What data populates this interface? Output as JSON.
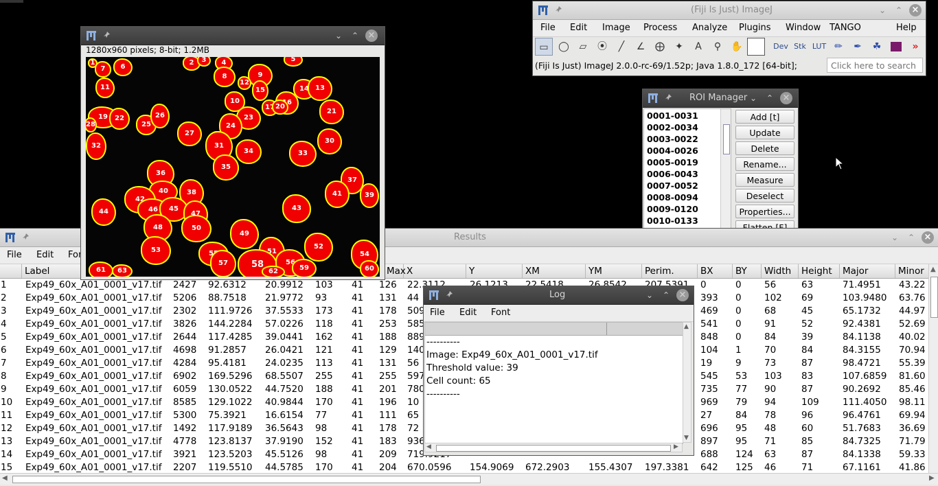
{
  "imagej": {
    "title": "(Fiji Is Just) ImageJ",
    "menus": [
      "File",
      "Edit",
      "Image",
      "Process",
      "Analyze",
      "Plugins",
      "Window",
      "TANGO",
      "Help"
    ],
    "tool_labels": {
      "dev": "Dev",
      "stk": "Stk",
      "lut": "LUT",
      "text": "A"
    },
    "status": "(Fiji Is Just) ImageJ 2.0.0-rc-69/1.52p; Java 1.8.0_172 [64-bit];",
    "search_placeholder": "Click here to search"
  },
  "image_window": {
    "info": "1280x960 pixels; 8-bit; 1.2MB",
    "cell_labels": [
      "1",
      "7",
      "6",
      "2",
      "3",
      "4",
      "5",
      "8",
      "11",
      "9",
      "12",
      "15",
      "14",
      "13",
      "10",
      "16",
      "17",
      "20",
      "21",
      "19",
      "22",
      "25",
      "26",
      "23",
      "24",
      "28",
      "27",
      "32",
      "29",
      "31",
      "30",
      "34",
      "33",
      "35",
      "36",
      "37",
      "38",
      "40",
      "42",
      "41",
      "39",
      "46",
      "45",
      "44",
      "47",
      "43",
      "48",
      "50",
      "49",
      "51",
      "52",
      "53",
      "55",
      "57",
      "58",
      "56",
      "54",
      "61",
      "63",
      "62",
      "59",
      "60"
    ]
  },
  "roi_manager": {
    "title": "ROI Manager",
    "items": [
      "0001-0031",
      "0002-0034",
      "0003-0022",
      "0004-0026",
      "0005-0019",
      "0006-0043",
      "0007-0052",
      "0008-0094",
      "0009-0120",
      "0010-0133"
    ],
    "buttons": [
      "Add [t]",
      "Update",
      "Delete",
      "Rename...",
      "Measure",
      "Deselect",
      "Properties...",
      "Flatten [F]"
    ]
  },
  "results": {
    "title": "Results",
    "menus": [
      "File",
      "Edit",
      "Font"
    ],
    "columns": [
      "",
      "Label",
      "",
      "",
      "",
      "",
      "",
      "Max",
      "X",
      "Y",
      "XM",
      "YM",
      "Perim.",
      "BX",
      "BY",
      "Width",
      "Height",
      "Major",
      "Minor"
    ],
    "rows": [
      [
        "1",
        "Exp49_60x_A01_0001_v17.tif",
        "2427",
        "92.6312",
        "20.9912",
        "103",
        "41",
        "126",
        "22.3112",
        "26.1213",
        "22.5418",
        "26.8542",
        "207.5391",
        "0",
        "0",
        "56",
        "63",
        "71.4951",
        "43.22"
      ],
      [
        "2",
        "Exp49_60x_A01_0001_v17.tif",
        "5206",
        "88.7518",
        "21.9772",
        "93",
        "41",
        "131",
        "44",
        "",
        "",
        "",
        "",
        "393",
        "0",
        "102",
        "69",
        "103.9480",
        "63.76"
      ],
      [
        "3",
        "Exp49_60x_A01_0001_v17.tif",
        "2302",
        "111.9726",
        "37.5533",
        "173",
        "41",
        "178",
        "509",
        "",
        "",
        "",
        "",
        "469",
        "0",
        "68",
        "45",
        "65.1732",
        "44.97"
      ],
      [
        "4",
        "Exp49_60x_A01_0001_v17.tif",
        "3826",
        "144.2284",
        "57.0226",
        "118",
        "41",
        "253",
        "585",
        "",
        "",
        "",
        "",
        "541",
        "0",
        "91",
        "52",
        "92.4381",
        "52.69"
      ],
      [
        "5",
        "Exp49_60x_A01_0001_v17.tif",
        "2644",
        "117.4285",
        "39.0441",
        "162",
        "41",
        "188",
        "889",
        "",
        "",
        "",
        "",
        "848",
        "0",
        "84",
        "39",
        "84.1138",
        "40.02"
      ],
      [
        "6",
        "Exp49_60x_A01_0001_v17.tif",
        "4698",
        "91.2857",
        "26.0421",
        "121",
        "41",
        "129",
        "140",
        "",
        "",
        "",
        "",
        "104",
        "1",
        "70",
        "84",
        "84.3155",
        "70.94"
      ],
      [
        "7",
        "Exp49_60x_A01_0001_v17.tif",
        "4284",
        "95.4181",
        "24.0235",
        "113",
        "41",
        "131",
        "56",
        "",
        "",
        "",
        "",
        "19",
        "9",
        "73",
        "87",
        "98.4721",
        "55.39"
      ],
      [
        "8",
        "Exp49_60x_A01_0001_v17.tif",
        "6902",
        "169.5296",
        "68.5507",
        "255",
        "41",
        "255",
        "597",
        "",
        "",
        "",
        "",
        "545",
        "53",
        "103",
        "83",
        "107.6859",
        "81.60"
      ],
      [
        "9",
        "Exp49_60x_A01_0001_v17.tif",
        "6059",
        "130.0522",
        "44.7520",
        "188",
        "41",
        "201",
        "780",
        "",
        "",
        "",
        "",
        "735",
        "77",
        "90",
        "87",
        "90.2692",
        "85.46"
      ],
      [
        "10",
        "Exp49_60x_A01_0001_v17.tif",
        "8585",
        "129.1022",
        "40.9844",
        "170",
        "41",
        "196",
        "10",
        "",
        "",
        "",
        "",
        "969",
        "79",
        "94",
        "109",
        "111.4050",
        "98.11"
      ],
      [
        "11",
        "Exp49_60x_A01_0001_v17.tif",
        "5300",
        "75.3921",
        "16.6154",
        "77",
        "41",
        "111",
        "65",
        "",
        "",
        "",
        "",
        "27",
        "84",
        "78",
        "96",
        "96.4761",
        "69.94"
      ],
      [
        "12",
        "Exp49_60x_A01_0001_v17.tif",
        "1492",
        "117.9189",
        "36.5643",
        "98",
        "41",
        "178",
        "72",
        "",
        "",
        "",
        "",
        "696",
        "95",
        "48",
        "60",
        "51.7683",
        "36.69"
      ],
      [
        "13",
        "Exp49_60x_A01_0001_v17.tif",
        "4778",
        "123.8137",
        "37.9190",
        "152",
        "41",
        "183",
        "936",
        "",
        "",
        "",
        "",
        "897",
        "95",
        "71",
        "85",
        "84.7325",
        "71.79"
      ],
      [
        "14",
        "Exp49_60x_A01_0001_v17.tif",
        "3921",
        "123.5203",
        "45.5126",
        "98",
        "41",
        "209",
        "719.9217",
        "",
        "",
        "",
        "",
        "688",
        "124",
        "63",
        "87",
        "84.1338",
        "59.33"
      ],
      [
        "15",
        "Exp49_60x_A01_0001_v17.tif",
        "2207",
        "119.5510",
        "44.5785",
        "170",
        "41",
        "204",
        "670.0596",
        "154.9069",
        "672.2903",
        "155.4307",
        "197.3381",
        "642",
        "125",
        "46",
        "71",
        "67.1161",
        "41.86"
      ]
    ]
  },
  "log": {
    "title": "Log",
    "menus": [
      "File",
      "Edit",
      "Font"
    ],
    "lines": [
      "----------",
      "Image: Exp49_60x_A01_0001_v17.tif",
      "Threshold value: 39",
      "Cell count: 65",
      "----------"
    ]
  },
  "colors": {
    "cell_fill": "#f00000",
    "cell_outline": "#ffff00",
    "title_dark": "#3b3b3b"
  }
}
